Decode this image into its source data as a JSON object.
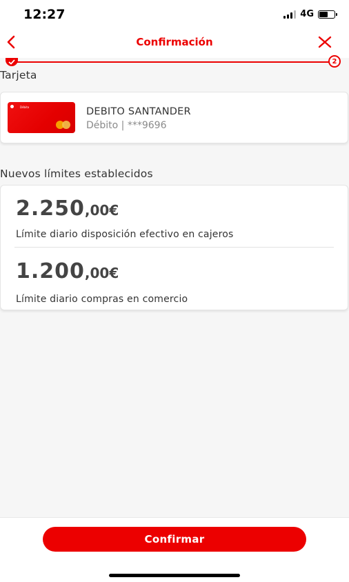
{
  "status": {
    "time": "12:27",
    "network": "4G"
  },
  "nav": {
    "title": "Confirmación"
  },
  "stepper": {
    "current_step": "2"
  },
  "card_section": {
    "label": "Tarjeta",
    "card_name": "DEBITO SANTANDER",
    "card_detail": "Débito | ***9696",
    "card_image_text": "Débito"
  },
  "limits_section": {
    "label": "Nuevos límites establecidos",
    "limits": [
      {
        "amount_int": "2.250",
        "amount_dec": ",00€",
        "description": "Límite diario disposición efectivo en cajeros"
      },
      {
        "amount_int": "1.200",
        "amount_dec": ",00€",
        "description": "Límite diario compras en comercio"
      }
    ]
  },
  "footer": {
    "confirm_label": "Confirmar"
  },
  "colors": {
    "brand": "#ec0000"
  }
}
